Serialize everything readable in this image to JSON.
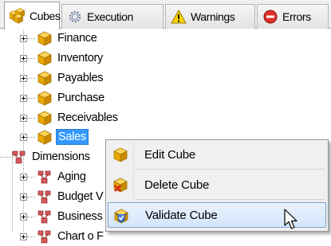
{
  "tabs": [
    {
      "label": "Cubes",
      "icon": "cubes-icon",
      "active": true
    },
    {
      "label": "Execution",
      "icon": "gear-icon",
      "active": false
    },
    {
      "label": "Warnings",
      "icon": "warning-icon",
      "active": false
    },
    {
      "label": "Errors",
      "icon": "error-icon",
      "active": false
    }
  ],
  "tree": {
    "cubes": [
      "Finance",
      "Inventory",
      "Payables",
      "Purchase",
      "Receivables",
      "Sales"
    ],
    "selected": "Sales",
    "dimensions": {
      "label": "Dimensions",
      "items": [
        "Aging",
        "Budget V",
        "Business",
        "Chart o F"
      ]
    }
  },
  "context_menu": {
    "items": [
      {
        "label": "Edit Cube",
        "icon": "cube-icon"
      },
      {
        "label": "Delete Cube",
        "icon": "delete-cube-icon"
      },
      {
        "label": "Validate Cube",
        "icon": "validate-cube-icon",
        "highlighted": true
      }
    ]
  },
  "colors": {
    "selection": "#3399ff",
    "menu_highlight_border": "#7da2ce",
    "cube_gold": "#e8a800"
  }
}
